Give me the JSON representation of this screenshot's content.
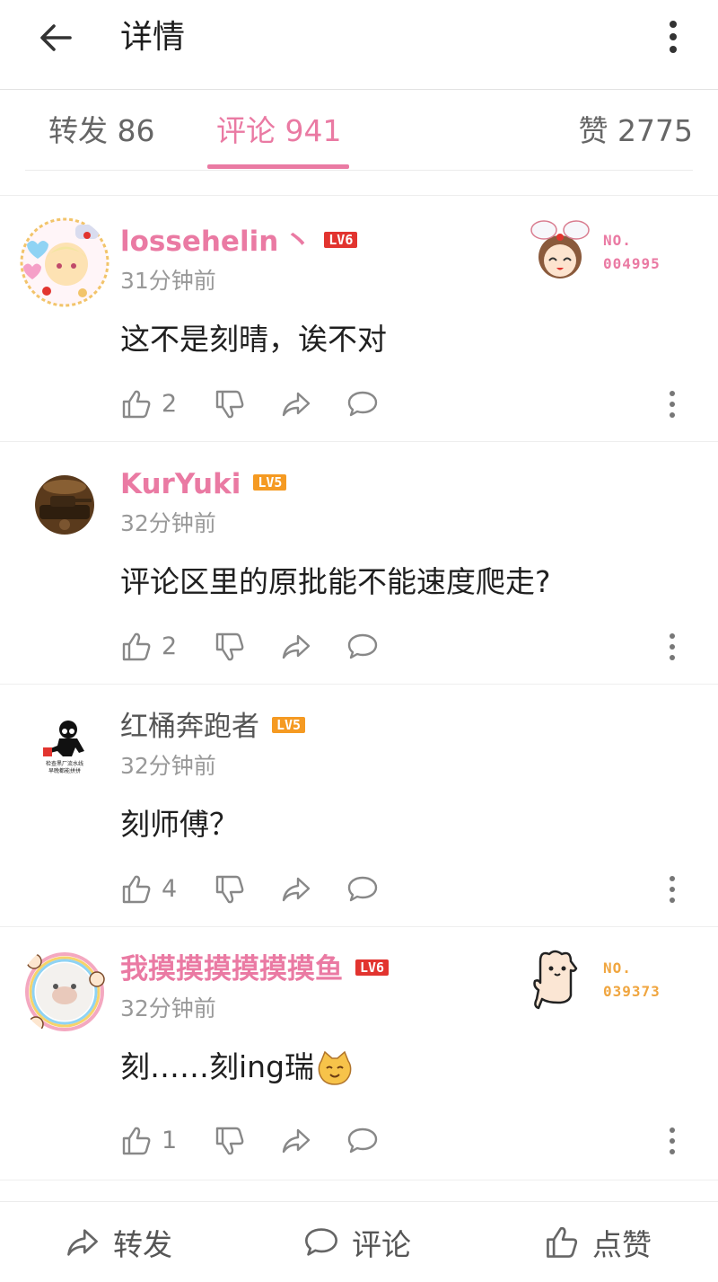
{
  "header": {
    "title": "详情",
    "back_icon": "arrow-left-icon",
    "more_icon": "more-vertical-icon"
  },
  "tabs": [
    {
      "label": "转发 86",
      "active": false
    },
    {
      "label": "评论 941",
      "active": true
    },
    {
      "label": "赞 2775",
      "active": false
    }
  ],
  "colors": {
    "accent": "#ea7aa3",
    "lv6": "#e2342f",
    "lv5": "#f59a22",
    "medal": "#f0a640"
  },
  "comments": [
    {
      "username": "lossehelin",
      "suffix": "丶",
      "level": "LV6",
      "time": "31分钟前",
      "content": "这不是刻晴，诶不对",
      "likes": "2",
      "medal": {
        "no_label": "NO.",
        "number": "004995"
      }
    },
    {
      "username": "KurYuki",
      "level": "LV5",
      "time": "32分钟前",
      "content": "评论区里的原批能不能速度爬走?",
      "likes": "2"
    },
    {
      "username": "红桶奔跑者",
      "level": "LV5",
      "time": "32分钟前",
      "content": "刻师傅？",
      "likes": "4",
      "avatar_text": "检查黑厂流水线 早晚都能拼拼"
    },
    {
      "username": "我摸摸摸摸摸摸鱼",
      "level": "LV6",
      "time": "32分钟前",
      "content": "刻……刻ing瑞",
      "likes": "1",
      "medal": {
        "no_label": "NO.",
        "number": "039373"
      }
    }
  ],
  "bottom_bar": {
    "repost": "转发",
    "comment": "评论",
    "like": "点赞"
  }
}
